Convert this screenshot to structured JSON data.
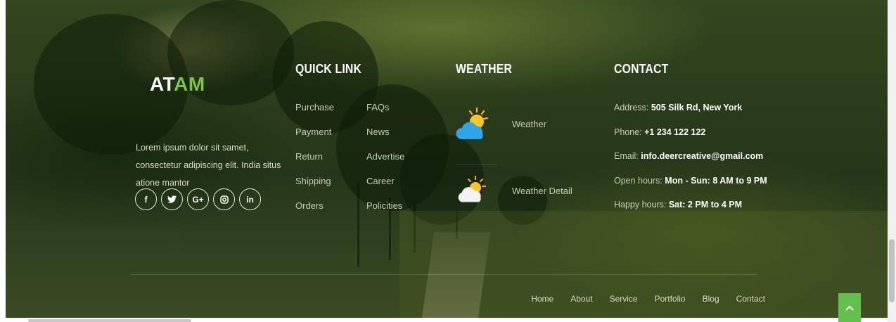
{
  "brand": {
    "part1": "AT",
    "part2": "AM"
  },
  "about": {
    "text": "Lorem ipsum dolor sit samet, consectetur adipiscing elit. India situs atione mantor"
  },
  "social": [
    {
      "label": "f",
      "icon": "facebook-icon"
    },
    {
      "label": "♥",
      "icon": "twitter-icon"
    },
    {
      "label": "G+",
      "icon": "google-plus-icon"
    },
    {
      "label": "◎",
      "icon": "instagram-icon"
    },
    {
      "label": "in",
      "icon": "linkedin-icon"
    }
  ],
  "quick_link": {
    "title": "QUICK LINK",
    "col1": [
      "Purchase",
      "Payment",
      "Return",
      "Shipping",
      "Orders"
    ],
    "col2": [
      "FAQs",
      "News",
      "Advertise",
      "Career",
      "Policities"
    ]
  },
  "weather": {
    "title": "WEATHER",
    "items": [
      {
        "label": "Weather",
        "icon": "sun-cloud-icon"
      },
      {
        "label": "Weather Detail",
        "icon": "sun-cloud-white-icon"
      }
    ]
  },
  "contact": {
    "title": "CONTACT",
    "address_label": "Address:",
    "address_value": "505 Silk Rd, New York",
    "phone_label": "Phone:",
    "phone_value": "+1 234 122 122",
    "email_label": "Email:",
    "email_value": "info.deercreative@gmail.com",
    "open_label": "Open hours:",
    "open_value": "Mon - Sun: 8 AM to 9 PM",
    "happy_label": "Happy hours:",
    "happy_value": "Sat: 2 PM to 4 PM"
  },
  "bottom_nav": [
    "Home",
    "About",
    "Service",
    "Portfolio",
    "Blog",
    "Contact"
  ],
  "colors": {
    "accent": "#7cc443",
    "back_to_top": "#63c04d"
  },
  "back_to_top": {
    "icon": "chevron-up-icon"
  }
}
